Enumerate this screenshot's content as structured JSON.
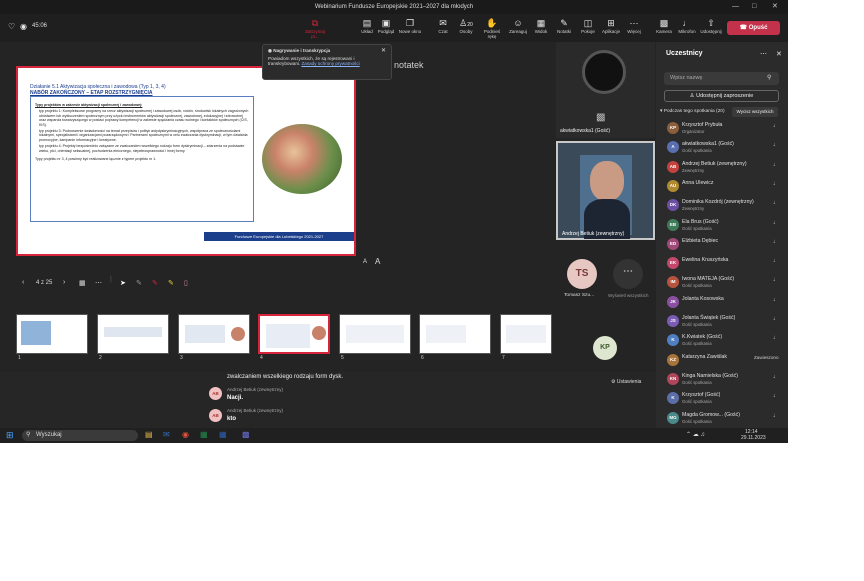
{
  "window": {
    "title": "Webinarium Fundusze Europejskie 2021–2027 dla młodych"
  },
  "meeting": {
    "timer": "45:06"
  },
  "toolbar": {
    "stop_presenting": "Zatrzymaj pr...",
    "view": "Widok",
    "people": "Osoby",
    "people_count": "20",
    "chat": "Czat",
    "raise_hand": "Podnieś rękę",
    "react": "Zareaguj",
    "views": "Widok",
    "notes": "Notatki",
    "rooms": "Pokoje",
    "apps": "Aplikacje",
    "more": "Więcej",
    "camera": "Kamera",
    "mic": "Mikrofon",
    "share": "Udostępnij",
    "layout": "Układ",
    "preview": "Podgląd",
    "new_window": "Nowe okno",
    "leave": "Opuść"
  },
  "notice": {
    "title": "Nagrywanie i transkrypcja",
    "text": "Powiadom wszystkich, że są rejestrowani i transkrybowani.",
    "link": "Zasady ochrony prywatności"
  },
  "stage": {
    "notes_label": "notatek"
  },
  "slide": {
    "heading": "Działanie 5.1 Aktywizacja społeczna i zawodowa (Typ 1, 3, 4)",
    "subheading": "NABÓR ZAKOŃCZONY – ETAP ROZSTRZYGNIĘCIA",
    "box_title": "Typy projektów w zakresie aktywizacji społecznej i zawodowej:",
    "bullets": [
      "typ projektu 1: Kompleksowe programy na rzecz aktywizacji społecznej i zawodowej osób, rodzin, środowisk lokalnych zagrożonych ubóstwem lub wykluczeniem społecznym przy użyciu instrumentów aktywizacji społecznej, zawodowej, edukacyjnej i zdrowotnej oraz wsparcia towarzyszącego w postaci poprawy kompetencji w zakresie spędzania czasu wolnego i kontaktów społecznych (CIS, KIS).",
      "typ projektu 3: Podnoszenie świadomości na temat przepisów i polityk antydyskryminacyjnych, współpraca ze społecznościami lokalnymi, specjalistami i organizacjami pozarządowymi i Partnerami społecznymi w celu zwalczania dyskryminacji, w tym działania promocyjne, kampanie informacyjne i kreatywne.",
      "typ projektu 4: Projekty bezpośrednio związane ze zwalczaniem wszelkiego rodzaju form dyskryminacji – zdarzenia na podstawie wieku, płci, orientacji seksualnej, pochodzenia etnicznego, niepełnosprawności i innej formy."
    ],
    "note": "Typy projektu nr 3, 4 powinny być realizowane łącznie z typem projektu nr 1.",
    "footer": "Fundusze Europejskie dla Lubelskiego 2021-2027"
  },
  "slide_controls": {
    "page": "4 z 25",
    "zoom_small": "A",
    "zoom_large": "A"
  },
  "thumbnails": [
    "1",
    "2",
    "3",
    "4",
    "5",
    "6",
    "7"
  ],
  "videos": {
    "tile1_name": "akwiatkowska1 (Gość)",
    "tile2_name": "Andrzej Betiuk (zewnętrzny)",
    "ts_initials": "TS",
    "ts_name": "Tomasz Szu...",
    "more_label": "Wyświetl wszystkich",
    "kp_initials": "KP"
  },
  "chat": {
    "line_top": "zwalczaniem wszelkiego rodzaju form dysk.",
    "settings": "Ustawienia",
    "messages": [
      {
        "initials": "AB",
        "author": "",
        "text": "Nacji."
      },
      {
        "initials": "AB",
        "author": "Andrzej Betiuk (zewnętrzny)",
        "text": "kto"
      }
    ],
    "author_top": "Andrzej Betiuk (zewnętrzny)"
  },
  "panel": {
    "title": "Uczestnicy",
    "search_placeholder": "Wpisz nazwę",
    "share_invite": "Udostępnij zaproszenie",
    "section": "Podczas tego spotkania (20)",
    "mute_all": "Wycisz wszystkich",
    "participants": [
      {
        "initials": "KP",
        "name": "Krzysztof Prybuła",
        "role": "Organizator",
        "color": "#8b5e3c"
      },
      {
        "initials": "A",
        "name": "akwiatkowska1 (Gość)",
        "role": "Gość spotkania",
        "color": "#5a6fb0"
      },
      {
        "initials": "AB",
        "name": "Andrzej Betiuk (zewnętrzny)",
        "role": "Zewnętrzny",
        "color": "#c3423f"
      },
      {
        "initials": "AU",
        "name": "Anna Ulewicz",
        "role": "",
        "color": "#b08a2e"
      },
      {
        "initials": "DK",
        "name": "Dominika Kozdrój (zewnętrzny)",
        "role": "Zewnętrzny",
        "color": "#6d4fa3"
      },
      {
        "initials": "EB",
        "name": "Ela Brus (Gość)",
        "role": "Gość spotkania",
        "color": "#3e7c5a"
      },
      {
        "initials": "ED",
        "name": "Elżbieta Dębiec",
        "role": "",
        "color": "#a04a7a"
      },
      {
        "initials": "EK",
        "name": "Ewelina Kruszyńska",
        "role": "",
        "color": "#c4486b"
      },
      {
        "initials": "IM",
        "name": "Iwona MATEJA (Gość)",
        "role": "Gość spotkania",
        "color": "#b5533c"
      },
      {
        "initials": "JK",
        "name": "Jolanta Kosowska",
        "role": "",
        "color": "#8a4fa0"
      },
      {
        "initials": "JS",
        "name": "Jolanta Świątek (Gość)",
        "role": "Gość spotkania",
        "color": "#7b5cb5"
      },
      {
        "initials": "K",
        "name": "K.Kwiatek (Gość)",
        "role": "Gość spotkania",
        "color": "#4f7fc0"
      },
      {
        "initials": "KZ",
        "name": "Katarzyna Zawiślak",
        "role": "",
        "color": "#a8743a",
        "status": "Zawieszono"
      },
      {
        "initials": "KN",
        "name": "Kinga Namielska (Gość)",
        "role": "Gość spotkania",
        "color": "#b0465a"
      },
      {
        "initials": "K",
        "name": "Krzysztof (Gość)",
        "role": "Gość spotkania",
        "color": "#5b6ea8"
      },
      {
        "initials": "MG",
        "name": "Magda Gromow... (Gość)",
        "role": "Gość spotkania",
        "color": "#4a8a8a"
      }
    ]
  },
  "taskbar": {
    "search": "Wyszukaj",
    "time": "12:14",
    "date": "29.11.2023"
  }
}
